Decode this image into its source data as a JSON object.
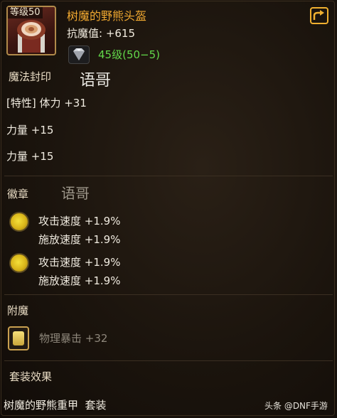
{
  "item": {
    "level_badge": "等级50",
    "name": "树魔的野熊头盔",
    "main_stat": "抗魔值: +615",
    "gem_text": "45级(50−5)",
    "name_color": "#f0a830",
    "gem_color": "#62d84a"
  },
  "watermarks": [
    "语哥",
    "语哥"
  ],
  "seal": {
    "header": "魔法封印",
    "lines": [
      "[特性] 体力 +31",
      "力量 +15",
      "力量 +15"
    ]
  },
  "emblem": {
    "header": "徽章",
    "slots": [
      {
        "lines": [
          "攻击速度 +1.9%",
          "施放速度 +1.9%"
        ]
      },
      {
        "lines": [
          "攻击速度 +1.9%",
          "施放速度 +1.9%"
        ]
      }
    ]
  },
  "enchant": {
    "header": "附魔",
    "text": "物理暴击 +32"
  },
  "set": {
    "header": "套装效果",
    "name_line": "树魔的野熊重甲  套装"
  },
  "footer": {
    "source": "头条 @DNF手游"
  },
  "icons": [
    "helmet-icon",
    "share-icon",
    "diamond-gem-icon",
    "emblem-icon",
    "enchant-card-icon"
  ]
}
